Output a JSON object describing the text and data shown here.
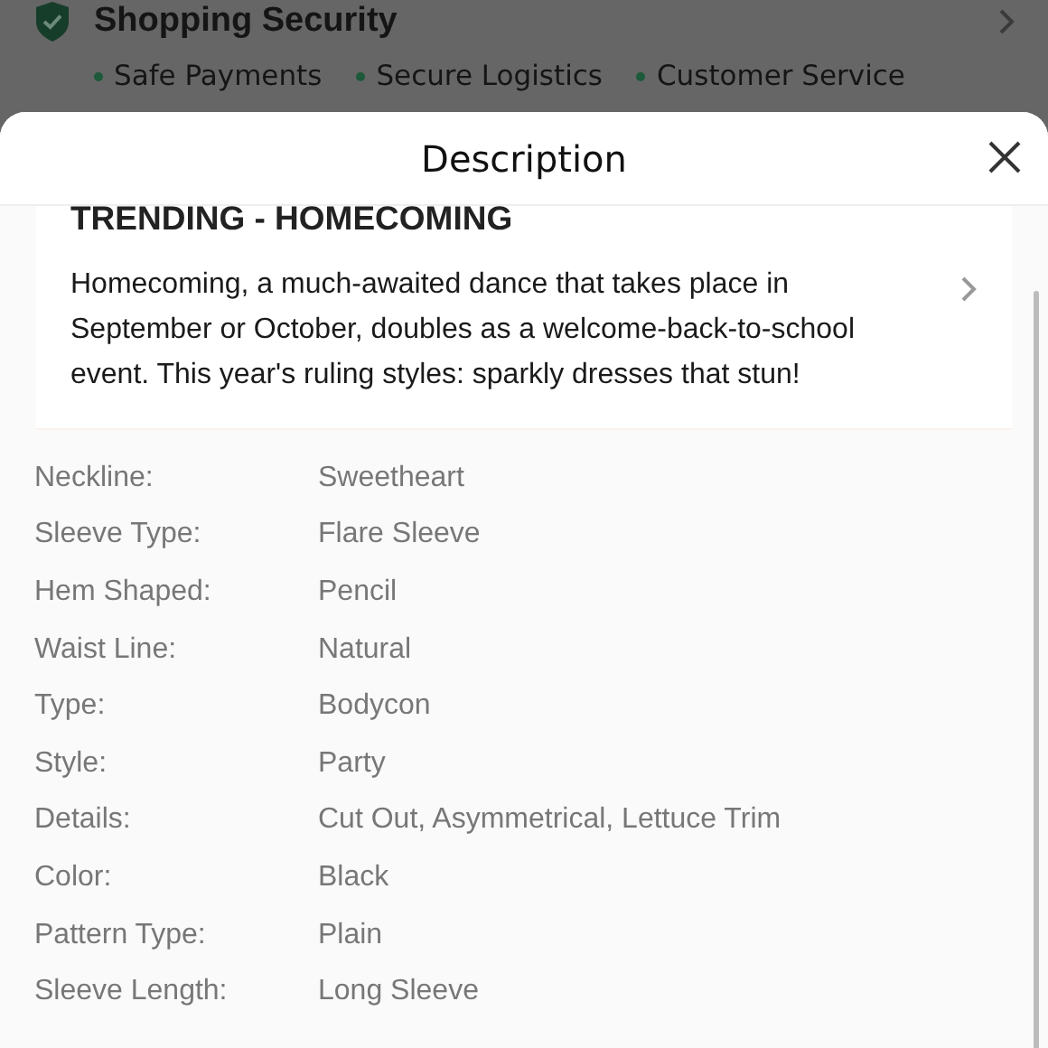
{
  "security": {
    "title": "Shopping Security",
    "points": [
      "Safe Payments",
      "Secure Logistics",
      "Customer Service"
    ]
  },
  "sheet": {
    "title": "Description",
    "trending": {
      "title": "TRENDING - HOMECOMING",
      "text": "Homecoming, a much-awaited dance that takes place in September or October, doubles as a welcome-back-to-school event. This year's ruling styles: sparkly dresses that stun!"
    },
    "specs": [
      {
        "label": "Neckline:",
        "value": "Sweetheart"
      },
      {
        "label": "Sleeve Type:",
        "value": "Flare Sleeve"
      },
      {
        "label": "Hem Shaped:",
        "value": "Pencil"
      },
      {
        "label": "Waist Line:",
        "value": "Natural"
      },
      {
        "label": "Type:",
        "value": "Bodycon"
      },
      {
        "label": "Style:",
        "value": "Party"
      },
      {
        "label": "Details:",
        "value": "Cut Out, Asymmetrical, Lettuce Trim"
      },
      {
        "label": "Color:",
        "value": "Black"
      },
      {
        "label": "Pattern Type:",
        "value": "Plain"
      },
      {
        "label": "Sleeve Length:",
        "value": "Long Sleeve"
      }
    ]
  }
}
